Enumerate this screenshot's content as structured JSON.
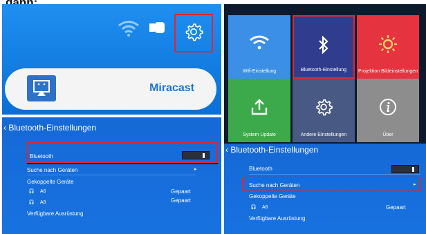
{
  "header_text": "dann:",
  "home": {
    "app_label": "Miracast",
    "icons": [
      "wifi-icon",
      "usb-icon",
      "gear-icon"
    ]
  },
  "tiles": [
    {
      "label": "Wifi-Einstellung",
      "icon": "wifi-icon",
      "color": "#3c8fe6"
    },
    {
      "label": "Bluetooth-Einstellung",
      "icon": "bluetooth-icon",
      "color": "#303d8f"
    },
    {
      "label": "Projektion Bildeinstellungen",
      "icon": "sun-icon",
      "color": "#e5333f"
    },
    {
      "label": "System Update",
      "icon": "upload-icon",
      "color": "#3caa4a"
    },
    {
      "label": "Andere Einstellungen",
      "icon": "gear-icon",
      "color": "#485a84"
    },
    {
      "label": "Über",
      "icon": "info-icon",
      "color": "#8d8d8d"
    }
  ],
  "bt_left": {
    "title": "Bluetooth-Einstellungen",
    "bluetooth_label": "Bluetooth",
    "search_label": "Suche nach Geräten",
    "paired_label": "Gekoppelte Geräte",
    "devices": [
      {
        "name": "A6",
        "status": "Gepaart"
      },
      {
        "name": "A8",
        "status": "Gepaart"
      }
    ],
    "available_label": "Verfügbare Ausrüstung"
  },
  "bt_right": {
    "title": "Bluetooth-Einstellungen",
    "bluetooth_label": "Bluetooth",
    "search_label": "Suche nach Geräten",
    "paired_label": "Gekoppelte Geräte",
    "devices": [
      {
        "name": "A6",
        "status": "Gepaart"
      }
    ],
    "available_label": "Verfügbare Ausrüstung"
  },
  "colors": {
    "accent_red": "#e0262e",
    "bt_blue": "#1772e0",
    "home_blue": "#0a6fd6"
  }
}
